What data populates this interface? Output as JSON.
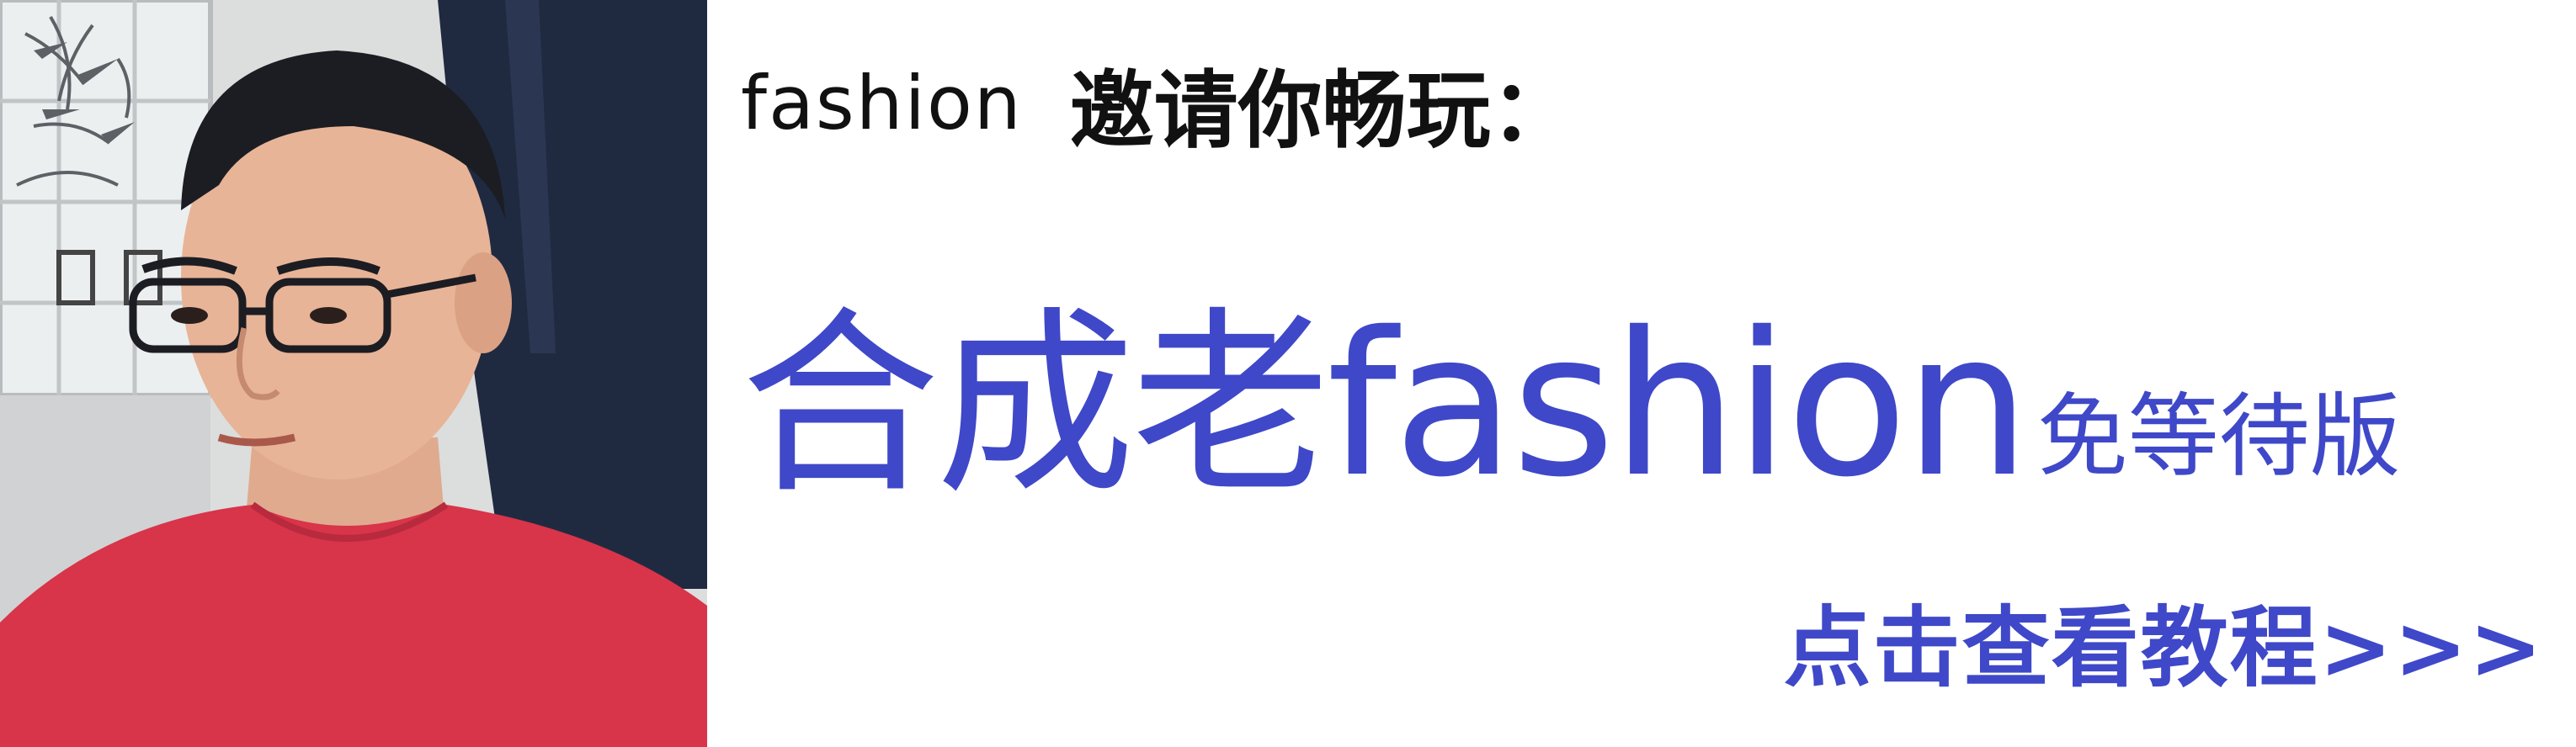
{
  "invite": {
    "brand": "fashion",
    "text": "邀请你畅玩："
  },
  "headline": {
    "main": "合成老fashion",
    "sub": "免等待版"
  },
  "cta": {
    "label": "点击查看教程>>>"
  },
  "photo": {
    "subject": "person-photo"
  },
  "colors": {
    "accent": "#3f48c8",
    "text_dark": "#111111",
    "background": "#ffffff",
    "shirt": "#d8344a"
  }
}
